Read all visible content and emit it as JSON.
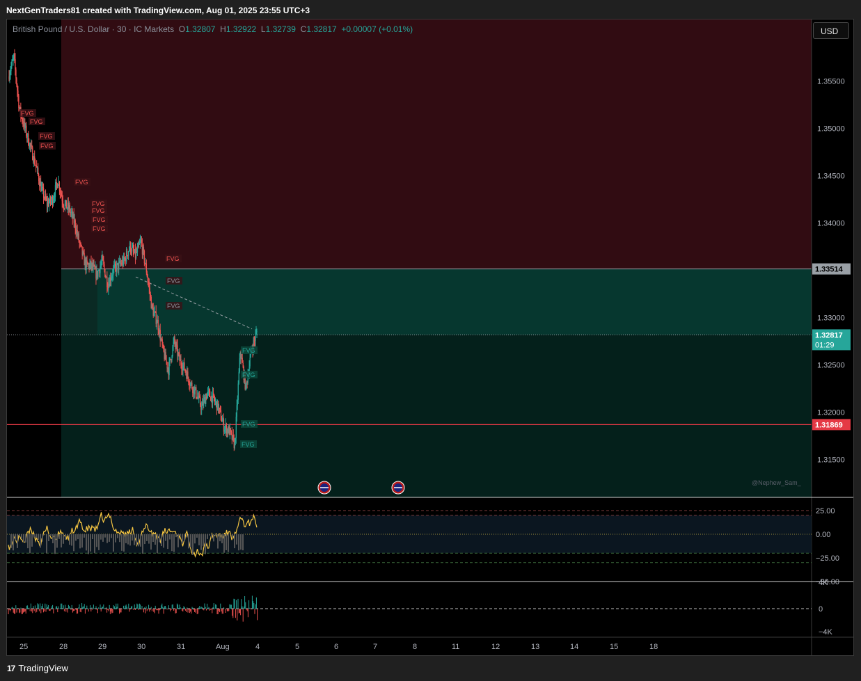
{
  "header": {
    "title": "NextGenTraders81 created with TradingView.com, Aug 01, 2025 23:55 UTC+3"
  },
  "symbol": {
    "name": "British Pound / U.S. Dollar · 30 · IC Markets",
    "o_label": "O",
    "o": "1.32807",
    "h_label": "H",
    "h": "1.32922",
    "l_label": "L",
    "l": "1.32739",
    "c_label": "C",
    "c": "1.32817",
    "change": "+0.00007 (+0.01%)"
  },
  "currency_button": "USD",
  "price_axis": {
    "ticks": [
      "1.35500",
      "1.35000",
      "1.34500",
      "1.34000",
      "1.33000",
      "1.32500",
      "1.32000",
      "1.31500"
    ],
    "tick_values": [
      1.355,
      1.35,
      1.345,
      1.34,
      1.33,
      1.325,
      1.32,
      1.315
    ],
    "label_upper_zone": "1.33514",
    "label_current": "1.32817",
    "label_countdown": "01:29",
    "label_level": "1.31869",
    "zone_top_value": 1.33514,
    "current_value": 1.32817,
    "level_value": 1.31869
  },
  "osc_axis": {
    "ticks": [
      "25.00",
      "0.00",
      "−25.00",
      "−50.00"
    ]
  },
  "vol_axis": {
    "ticks": [
      "4K",
      "0",
      "−4K"
    ]
  },
  "time_axis": {
    "labels": [
      "25",
      "28",
      "29",
      "30",
      "31",
      "Aug",
      "4",
      "5",
      "6",
      "7",
      "8",
      "11",
      "12",
      "13",
      "14",
      "15",
      "18"
    ]
  },
  "fvg_label": "FVG",
  "watermark": "@Nephew_Sam_",
  "events": [
    {
      "name": "us-flag-icon"
    },
    {
      "name": "uk-flag-icon"
    }
  ],
  "brand": "TradingView",
  "colors": {
    "bear_zone": "#310c12",
    "bull_zone": "#06372f",
    "dark_zone": "#04201b",
    "up": "#26a69a",
    "down": "#ef5350",
    "level_line": "#e53945",
    "osc_line": "#f5c542"
  },
  "chart_data": {
    "type": "candlestick",
    "instrument": "British Pound / U.S. Dollar",
    "timeframe": "30",
    "ylim": [
      1.311,
      1.3615
    ],
    "path": [
      1.3555,
      1.3575,
      1.352,
      1.35,
      1.348,
      1.346,
      1.3435,
      1.342,
      1.3425,
      1.3445,
      1.342,
      1.3415,
      1.34,
      1.3375,
      1.3355,
      1.3355,
      1.3345,
      1.336,
      1.3335,
      1.335,
      1.3355,
      1.336,
      1.3375,
      1.3365,
      1.338,
      1.335,
      1.331,
      1.3295,
      1.3265,
      1.3245,
      1.3275,
      1.3255,
      1.3245,
      1.323,
      1.322,
      1.3205,
      1.322,
      1.3215,
      1.3205,
      1.3185,
      1.318,
      1.3165,
      1.3265,
      1.3225,
      1.3265,
      1.3285
    ]
  }
}
